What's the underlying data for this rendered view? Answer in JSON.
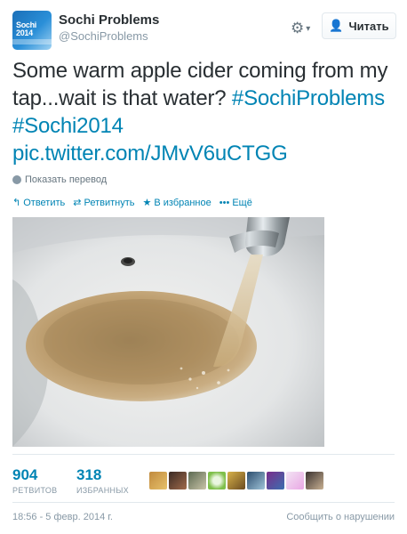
{
  "author": {
    "name": "Sochi Problems",
    "handle": "@SochiProblems",
    "avatar_icon": "sochi-2014-logo-icon",
    "avatar_text": "Sochi 2014"
  },
  "menu_icon": "gear-icon",
  "follow_button": {
    "label": "Читать",
    "icon": "add-user-icon"
  },
  "tweet": {
    "text": "Some warm apple cider coming from my tap...wait is that water?",
    "hashtags": [
      "#SochiProblems",
      "#Sochi2014"
    ],
    "link": "pic.twitter.com/JMvV6uCTGG"
  },
  "translate_label": "Показать перевод",
  "actions": {
    "reply": "Ответить",
    "retweet": "Ретвитнуть",
    "favorite": "В избранное",
    "more": "Ещё"
  },
  "photo": {
    "icon": "tweet-photo-image"
  },
  "stats": {
    "retweets": {
      "count": "904",
      "label": "РЕТВИТОВ"
    },
    "favorites": {
      "count": "318",
      "label": "ИЗБРАННЫХ"
    }
  },
  "footer": {
    "timestamp": "18:56 - 5 февр. 2014 г.",
    "report": "Сообщить о нарушении"
  },
  "colors": {
    "link": "#0084b4",
    "text": "#292f33",
    "muted": "#8899a6"
  }
}
